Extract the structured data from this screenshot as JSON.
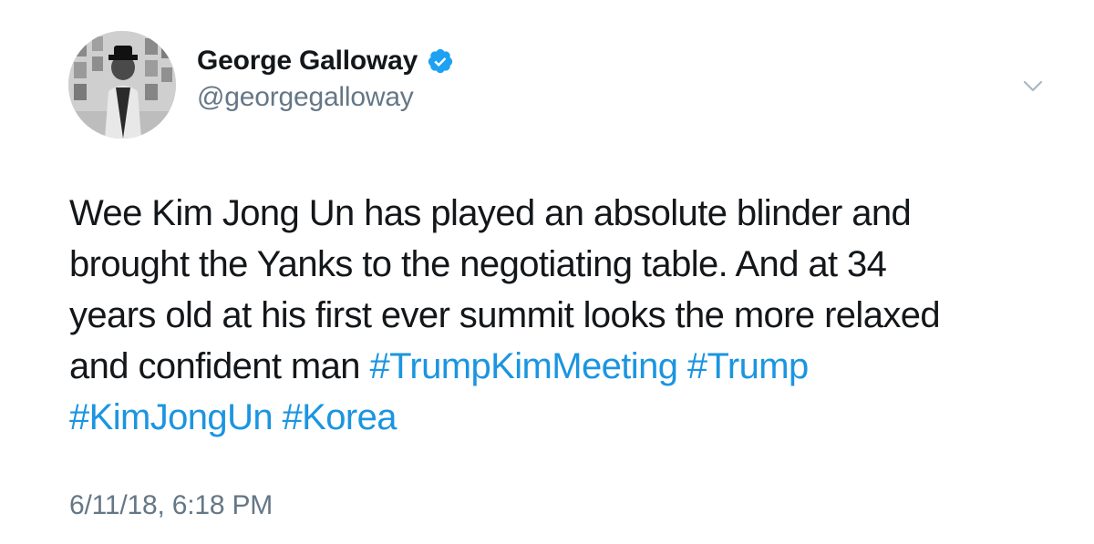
{
  "author": {
    "display_name": "George Galloway",
    "handle": "@georgegalloway",
    "verified": true,
    "avatar_icon": "profile-photo",
    "verified_icon": "verified-badge-icon"
  },
  "menu": {
    "icon": "chevron-down-icon"
  },
  "tweet": {
    "line1": "Wee Kim Jong Un has played an absolute blinder and",
    "line2": "brought the Yanks to the negotiating table. And at 34",
    "line3": "years old at his first ever summit looks the more relaxed",
    "line4_text": "and confident man ",
    "hashtags": [
      "#TrumpKimMeeting",
      "#Trump",
      "#KimJongUn",
      "#Korea"
    ],
    "timestamp": "6/11/18, 6:18 PM"
  },
  "colors": {
    "text": "#14171a",
    "secondary": "#657786",
    "link": "#1b95e0",
    "verified": "#1da1f2",
    "background": "#ffffff"
  }
}
